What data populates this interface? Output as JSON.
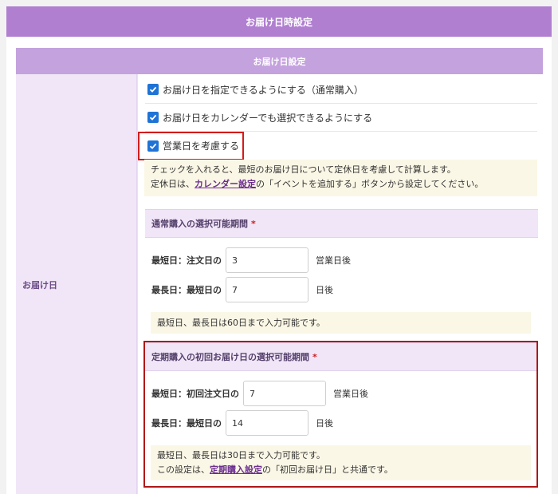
{
  "header": {
    "title": "お届け日時設定"
  },
  "section": {
    "title": "お届け日設定"
  },
  "row_label": "お届け日",
  "checkboxes": [
    {
      "label": "お届け日を指定できるようにする（通常購入）",
      "checked": true
    },
    {
      "label": "お届け日をカレンダーでも選択できるようにする",
      "checked": true
    },
    {
      "label": "営業日を考慮する",
      "checked": true
    }
  ],
  "note_business_days": {
    "line1": "チェックを入れると、最短のお届け日について定休日を考慮して計算します。",
    "line2_pre": "定休日は、",
    "line2_link": "カレンダー設定",
    "line2_post": "の「イベントを追加する」ボタンから設定してください。"
  },
  "normal_period": {
    "title": "通常購入の選択可能期間",
    "required_mark": "*",
    "shortest_label": "最短日：注文日の",
    "shortest_value": "3",
    "shortest_unit": "営業日後",
    "longest_label": "最長日：最短日の",
    "longest_value": "7",
    "longest_unit": "日後",
    "note": "最短日、最長日は60日まで入力可能です。"
  },
  "subscription_period": {
    "title": "定期購入の初回お届け日の選択可能期間",
    "required_mark": "*",
    "shortest_label": "最短日：初回注文日の",
    "shortest_value": "7",
    "shortest_unit": "営業日後",
    "longest_label": "最長日：最短日の",
    "longest_value": "14",
    "longest_unit": "日後",
    "note_line1": "最短日、最長日は30日まで入力可能です。",
    "note_line2_pre": "この設定は、",
    "note_line2_link": "定期購入設定",
    "note_line2_post": "の「初回お届け日」と共通です。"
  },
  "colors": {
    "header_bg": "#b07fd0",
    "subheader_bg": "#c4a2de",
    "checkbox": "#1e73d6",
    "highlight": "#d21c1c",
    "link": "#6a2d8f"
  }
}
